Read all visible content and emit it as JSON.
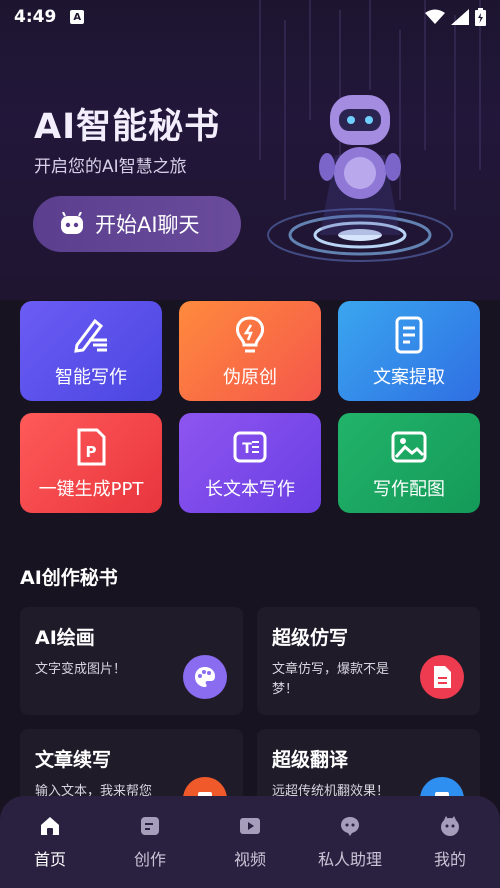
{
  "status_bar": {
    "time": "4:49",
    "a_icon": "A"
  },
  "hero": {
    "title": "AI智能秘书",
    "subtitle": "开启您的AI智慧之旅",
    "chat_button": "开始AI聊天"
  },
  "tools": [
    {
      "label": "智能写作",
      "icon": "pen-icon",
      "color_from": "#6b5cf5",
      "color_to": "#4b46e0"
    },
    {
      "label": "伪原创",
      "icon": "bulb-icon",
      "color_from": "#ff8a3d",
      "color_to": "#f4574b"
    },
    {
      "label": "文案提取",
      "icon": "document-icon",
      "color_from": "#3aa6ef",
      "color_to": "#2f6fe3"
    },
    {
      "label": "一键生成PPT",
      "icon": "ppt-icon",
      "color_from": "#ff5a5a",
      "color_to": "#e8353d"
    },
    {
      "label": "长文本写作",
      "icon": "text-icon",
      "color_from": "#8e55f0",
      "color_to": "#6a3fe3"
    },
    {
      "label": "写作配图",
      "icon": "image-icon",
      "color_from": "#22b36a",
      "color_to": "#149a58"
    }
  ],
  "section": {
    "title": "AI创作秘书"
  },
  "cards": [
    {
      "title": "AI绘画",
      "desc": "文字变成图片！",
      "icon": "palette-icon",
      "color": "#8a6cf0"
    },
    {
      "title": "超级仿写",
      "desc": "文章仿写，爆款不是梦！",
      "icon": "file-icon",
      "color": "#ef3b4f"
    },
    {
      "title": "文章续写",
      "desc": "输入文本，我来帮您",
      "icon": "continue-icon",
      "color": "#f05a2a"
    },
    {
      "title": "超级翻译",
      "desc": "远超传统机翻效果！",
      "icon": "translate-icon",
      "color": "#2f8ff0"
    }
  ],
  "tabbar": {
    "items": [
      {
        "label": "首页",
        "icon": "home-icon"
      },
      {
        "label": "创作",
        "icon": "create-icon"
      },
      {
        "label": "视频",
        "icon": "video-icon"
      },
      {
        "label": "私人助理",
        "icon": "assistant-icon"
      },
      {
        "label": "我的",
        "icon": "profile-icon"
      }
    ],
    "active_index": 0
  }
}
